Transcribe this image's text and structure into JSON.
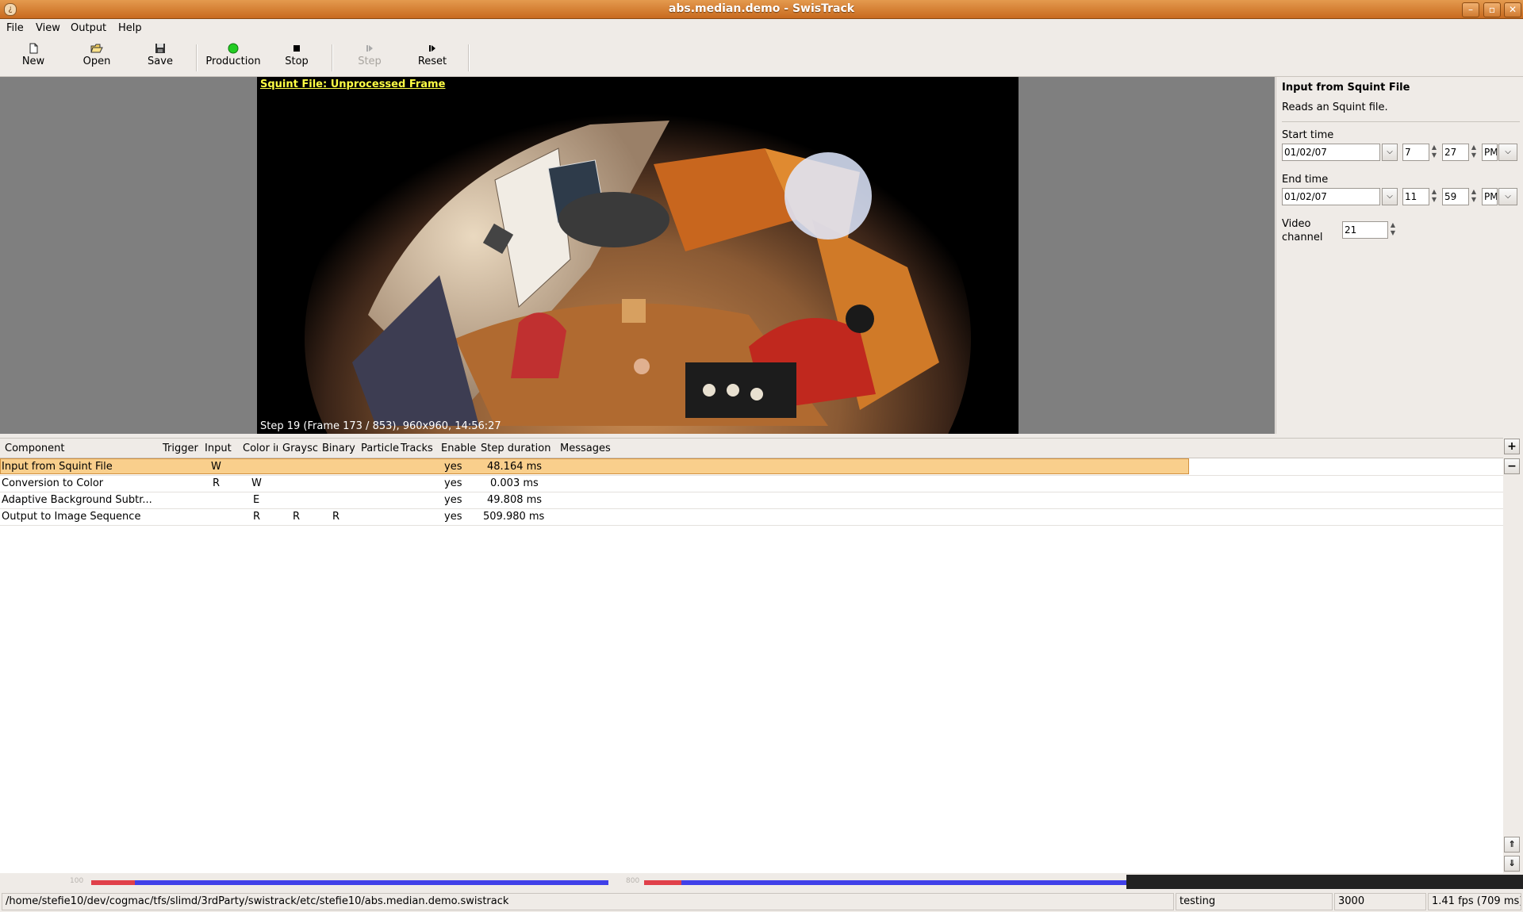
{
  "window": {
    "title": "abs.median.demo - SwisTrack"
  },
  "menu": [
    {
      "label": "File"
    },
    {
      "label": "View"
    },
    {
      "label": "Output"
    },
    {
      "label": "Help"
    }
  ],
  "toolbar": {
    "new": "New",
    "open": "Open",
    "save": "Save",
    "production": "Production",
    "stop": "Stop",
    "step": "Step",
    "reset": "Reset"
  },
  "video": {
    "frame_title": "Squint File: Unprocessed Frame",
    "status": "Step 19 (Frame 173 / 853), 960x960, 14:56:27"
  },
  "panel": {
    "title": "Input from Squint File",
    "description": "Reads an Squint file.",
    "start_label": "Start time",
    "start_date": "01/02/07",
    "start_hour": "7",
    "start_min": "27",
    "start_ampm": "PM",
    "end_label": "End time",
    "end_date": "01/02/07",
    "end_hour": "11",
    "end_min": "59",
    "end_ampm": "PM",
    "channel_label_1": "Video",
    "channel_label_2": "channel",
    "channel_value": "21"
  },
  "table": {
    "headers": [
      "Component",
      "Trigger",
      "Input",
      "Color ir",
      "Graysc",
      "Binary",
      "Particle",
      "Tracks",
      "Enable",
      "Step duration",
      "Messages"
    ],
    "rows": [
      {
        "component": "Input from Squint File",
        "trigger": "",
        "input": "W",
        "color": "",
        "gray": "",
        "binary": "",
        "particle": "",
        "tracks": "",
        "enable": "yes",
        "duration": "48.164 ms"
      },
      {
        "component": "Conversion to Color",
        "trigger": "",
        "input": "R",
        "color": "W",
        "gray": "",
        "binary": "",
        "particle": "",
        "tracks": "",
        "enable": "yes",
        "duration": "0.003 ms"
      },
      {
        "component": "Adaptive Background Subtr...",
        "trigger": "",
        "input": "",
        "color": "E",
        "gray": "",
        "binary": "",
        "particle": "",
        "tracks": "",
        "enable": "yes",
        "duration": "49.808 ms"
      },
      {
        "component": "Output to Image Sequence",
        "trigger": "",
        "input": "",
        "color": "R",
        "gray": "R",
        "binary": "R",
        "particle": "",
        "tracks": "",
        "enable": "yes",
        "duration": "509.980 ms"
      }
    ]
  },
  "timeline": {
    "label_1": "100",
    "label_2": "800"
  },
  "statusbar": {
    "path": "/home/stefie10/dev/cogmac/tfs/slimd/3rdParty/swistrack/etc/stefie10/abs.median.demo.swistrack",
    "mode": "testing",
    "port": "3000",
    "fps": "1.41 fps (709 ms)"
  },
  "colors": {
    "titlebar": "#d07a30",
    "selection": "#f9cf8c",
    "frame_title": "#ffff44",
    "timeline_red": "#e0404a",
    "timeline_blue": "#4040e8"
  }
}
